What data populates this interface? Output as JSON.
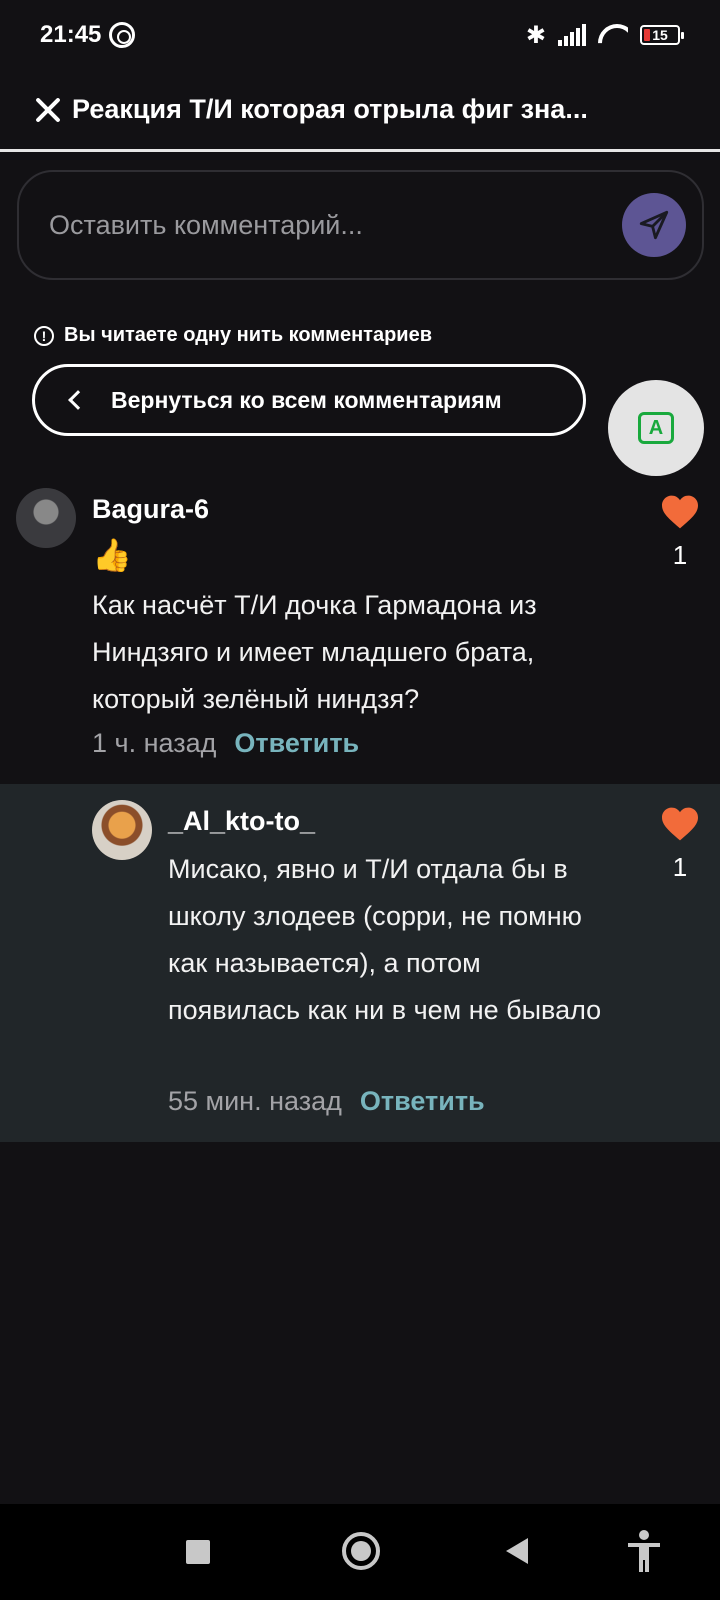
{
  "status_bar": {
    "time": "21:45",
    "battery": "15"
  },
  "header": {
    "title": "Реакция Т/И которая отрыла фиг зна..."
  },
  "comment_input": {
    "placeholder": "Оставить комментарий..."
  },
  "thread": {
    "notice": "Вы читаете одну нить комментариев",
    "back_label": "Вернуться ко всем комментариям"
  },
  "comments": [
    {
      "username": "Bagura-6",
      "emoji": "👍",
      "text": "Как насчёт Т/И дочка Гармадона из Ниндзяго и имеет младшего брата, который зелёный ниндзя?",
      "time": "1 ч. назад",
      "reply_label": "Ответить",
      "likes": "1"
    },
    {
      "username": "_Al_kto-to_",
      "text": "Мисако, явно и Т/И отдала бы в школу злодеев (сорри, не помню как называется), а потом появилась как ни в чем не бывало",
      "time": "55 мин. назад",
      "reply_label": "Ответить",
      "likes": "1"
    }
  ],
  "colors": {
    "like": "#f26b3a",
    "reply_link": "#78b4bd",
    "send_button": "#5d5594",
    "reply_bg": "#212629"
  }
}
